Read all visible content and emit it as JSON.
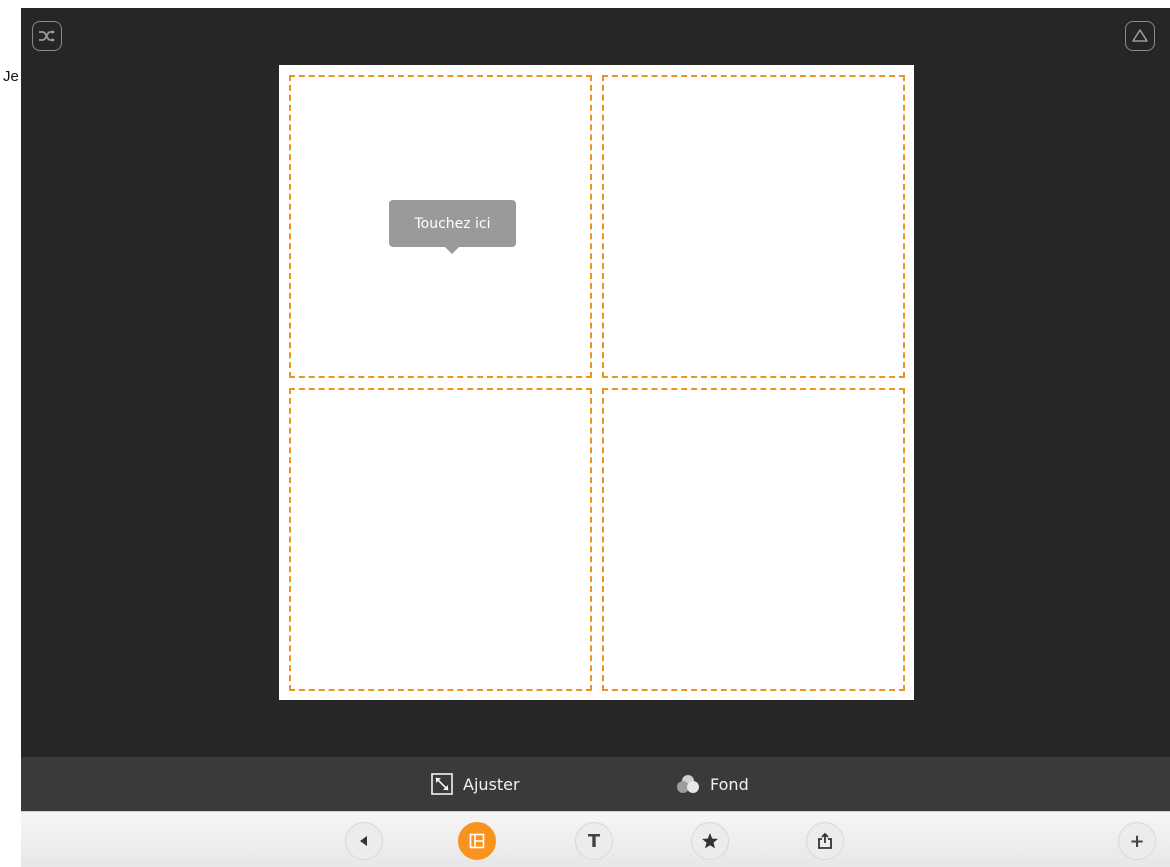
{
  "stray_text": "Je",
  "icons": {
    "shuffle": "shuffle-icon",
    "recycle": "recycle-icon",
    "resize": "resize-icon",
    "background": "background-circles-icon",
    "back": "back-arrow-icon",
    "layout": "layout-grid-icon",
    "text": "text-icon",
    "star": "star-icon",
    "share": "share-icon",
    "add": "plus-icon"
  },
  "canvas": {
    "tooltip": "Touchez ici",
    "cells": [
      "cell-1",
      "cell-2",
      "cell-3",
      "cell-4"
    ]
  },
  "options": {
    "ajuster_label": "Ajuster",
    "fond_label": "Fond"
  },
  "toolbar": {
    "text_glyph": "T",
    "add_glyph": "+",
    "active": "layout"
  },
  "colors": {
    "app_bg": "#262626",
    "accent": "#f7931e",
    "dashed": "#e8961f",
    "tooltip_bg": "#9a9a9a",
    "options_bar": "#3a3a3a"
  }
}
